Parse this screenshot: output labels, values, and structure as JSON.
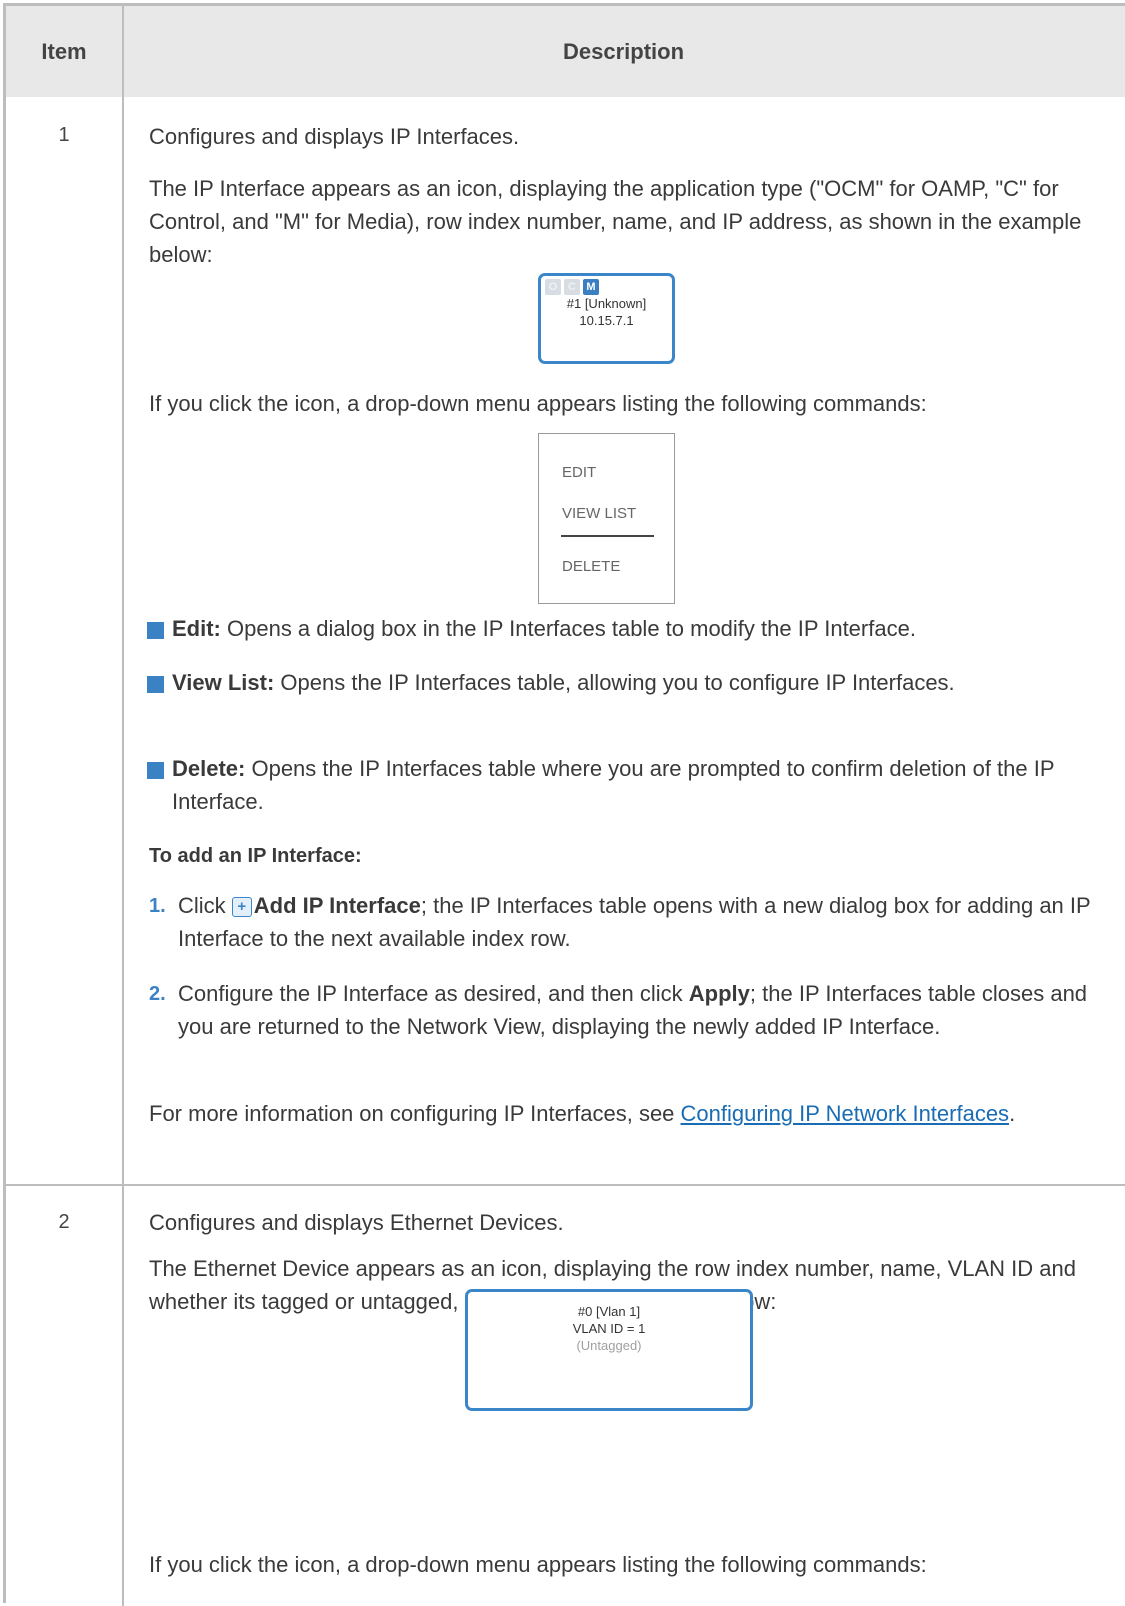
{
  "header": {
    "item": "Item",
    "description": "Description"
  },
  "row1": {
    "number": "1",
    "intro": "Configures and displays IP Interfaces.",
    "icon_desc": "The IP Interface appears as an icon, displaying the application type (\"OCM\" for OAMP, \"C\" for Control, and \"M\" for Media), row index number, name, and IP address, as shown in the example below:",
    "ip_icon": {
      "badge_o": "O",
      "badge_c": "C",
      "badge_m": "M",
      "line1": "#1 [Unknown]",
      "line2": "10.15.7.1"
    },
    "click_text": "If you click the icon, a drop-down menu appears listing the following commands:",
    "menu": {
      "edit": "EDIT",
      "view_list": "VIEW LIST",
      "delete": "DELETE"
    },
    "bullets": [
      {
        "label": "Edit:",
        "text": " Opens a dialog box in the IP Interfaces table to modify the IP Interface."
      },
      {
        "label": "View List:",
        "text": " Opens the IP Interfaces table, allowing you to configure IP Interfaces."
      },
      {
        "label": "Delete:",
        "text": " Opens the IP Interfaces table where you are prompted to confirm deletion of the IP Interface."
      }
    ],
    "add_heading": "To add an IP Interface:",
    "steps": [
      {
        "num": "1.",
        "pre": "Click ",
        "bold": "Add IP Interface",
        "post": "; the IP Interfaces table opens with a new dialog box for adding an IP Interface to the next available index row."
      },
      {
        "num": "2.",
        "pre": "Configure the IP Interface as desired, and then click ",
        "bold": "Apply",
        "post": "; the IP Interfaces table closes and you are returned to the Network View, displaying the newly added IP Interface."
      }
    ],
    "more_pre": "For more information on configuring IP Interfaces, see ",
    "more_link": "Configuring IP Network Interfaces",
    "more_post": "."
  },
  "row2": {
    "number": "2",
    "intro": "Configures and displays Ethernet Devices.",
    "icon_desc": "The Ethernet Device appears as an icon, displaying the row index number, name, VLAN ID and whether its tagged or untagged, as shown in the example below:",
    "eth_icon": {
      "line1": "#0 [Vlan 1]",
      "line2": "VLAN ID = 1",
      "line3": "(Untagged)"
    },
    "click_text": "If you click the icon, a drop-down menu appears listing the following commands:"
  },
  "colors": {
    "accent": "#3b82c4",
    "link": "#1a6db5",
    "header_bg": "#e8e8e8",
    "border": "#bdbdbd"
  }
}
